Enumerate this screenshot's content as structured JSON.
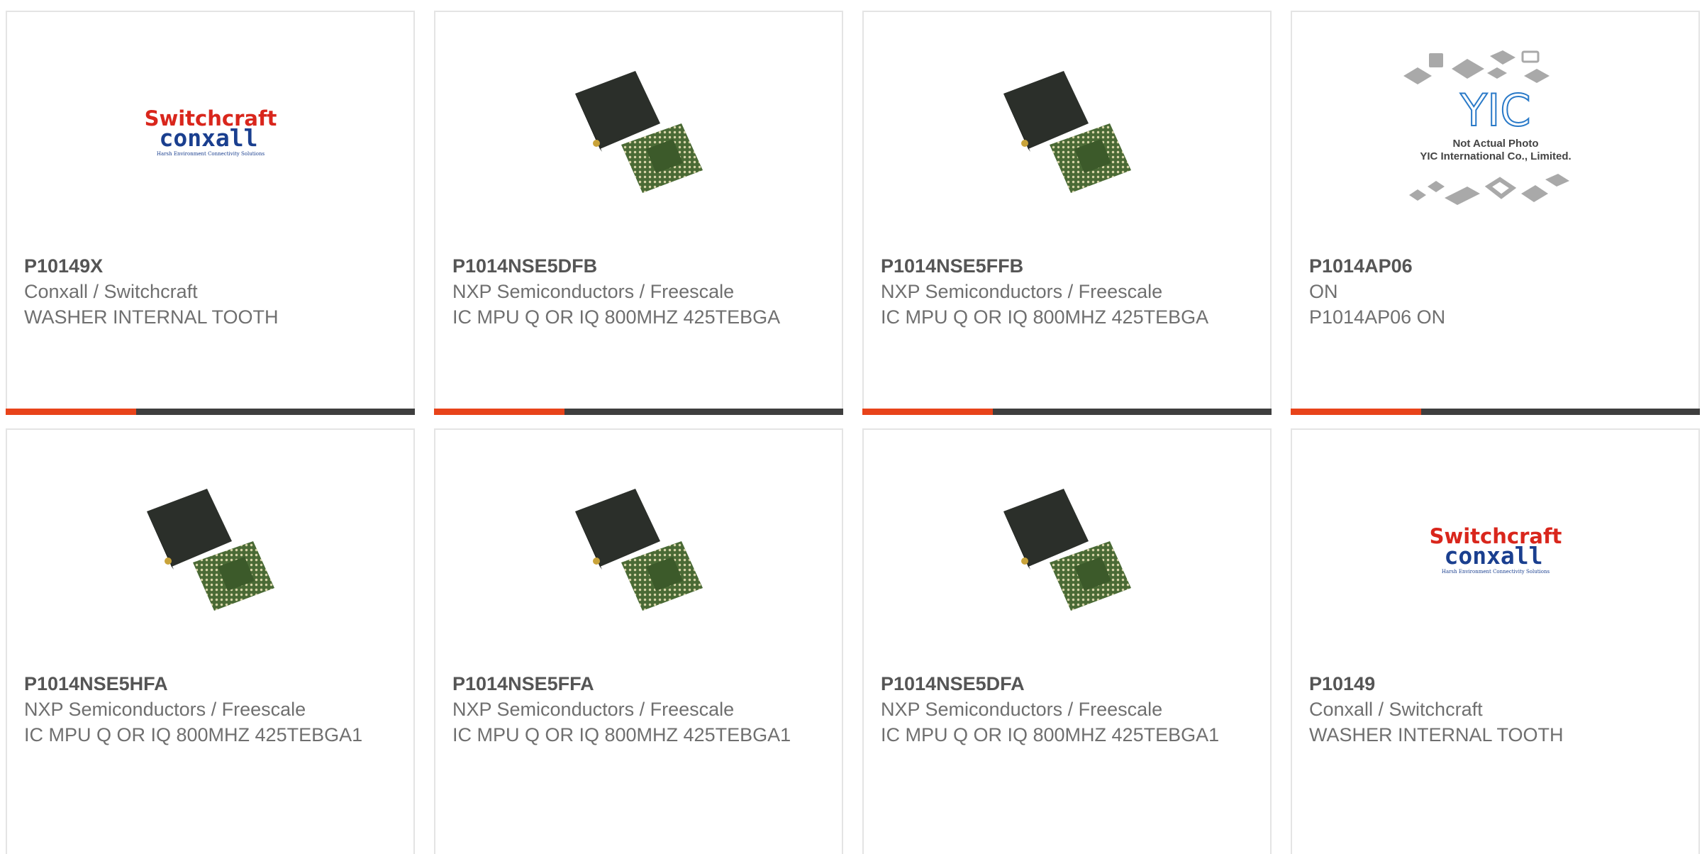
{
  "products": [
    {
      "part": "P10149X",
      "manufacturer": "Conxall / Switchcraft",
      "description": "WASHER INTERNAL TOOTH",
      "image": "switchcraft-conxall-logo",
      "logo": {
        "brand": "Switchcraft",
        "sub": "conxall",
        "tagline": "Harsh Environment Connectivity Solutions"
      }
    },
    {
      "part": "P1014NSE5DFB",
      "manufacturer": "NXP Semiconductors / Freescale",
      "description": "IC MPU Q OR IQ 800MHZ 425TEBGA",
      "image": "bga-chip-photo"
    },
    {
      "part": "P1014NSE5FFB",
      "manufacturer": "NXP Semiconductors / Freescale",
      "description": "IC MPU Q OR IQ 800MHZ 425TEBGA",
      "image": "bga-chip-photo"
    },
    {
      "part": "P1014AP06",
      "manufacturer": "ON",
      "description": "P1014AP06 ON",
      "image": "yic-not-actual-photo",
      "placeholder": {
        "brand": "YIC",
        "line1": "Not Actual Photo",
        "line2": "YIC International Co., Limited."
      }
    },
    {
      "part": "P1014NSE5HFA",
      "manufacturer": "NXP Semiconductors / Freescale",
      "description": "IC MPU Q OR IQ 800MHZ 425TEBGA1",
      "image": "bga-chip-photo"
    },
    {
      "part": "P1014NSE5FFA",
      "manufacturer": "NXP Semiconductors / Freescale",
      "description": "IC MPU Q OR IQ 800MHZ 425TEBGA1",
      "image": "bga-chip-photo"
    },
    {
      "part": "P1014NSE5DFA",
      "manufacturer": "NXP Semiconductors / Freescale",
      "description": "IC MPU Q OR IQ 800MHZ 425TEBGA1",
      "image": "bga-chip-photo"
    },
    {
      "part": "P10149",
      "manufacturer": "Conxall / Switchcraft",
      "description": "WASHER INTERNAL TOOTH",
      "image": "switchcraft-conxall-logo",
      "logo": {
        "brand": "Switchcraft",
        "sub": "conxall",
        "tagline": "Harsh Environment Connectivity Solutions"
      }
    }
  ],
  "colors": {
    "accent": "#e8431a",
    "bar": "#3e3e3e",
    "logo_red": "#d9261c",
    "logo_blue": "#1a3f8f",
    "yic_blue": "#2a7ac8"
  }
}
